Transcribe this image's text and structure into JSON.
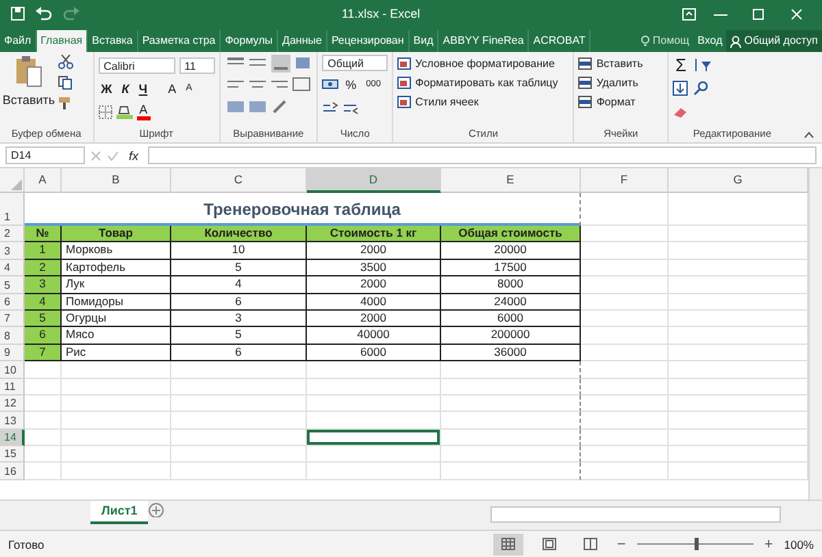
{
  "title_bar": {
    "title": "11.xlsx - Excel"
  },
  "menu_tabs": [
    {
      "label": "Файл",
      "selected": false
    },
    {
      "label": "Главная",
      "selected": true
    },
    {
      "label": "Вставка",
      "selected": false
    },
    {
      "label": "Разметка стра",
      "selected": false
    },
    {
      "label": "Формулы",
      "selected": false
    },
    {
      "label": "Данные",
      "selected": false
    },
    {
      "label": "Рецензирован",
      "selected": false
    },
    {
      "label": "Вид",
      "selected": false
    },
    {
      "label": "ABBYY FineRea",
      "selected": false
    },
    {
      "label": "ACROBAT",
      "selected": false
    }
  ],
  "help": "Помощ",
  "sign_in": "Вход",
  "share": "Общий доступ",
  "ribbon": {
    "clipboard": {
      "label": "Буфер обмена",
      "paste": "Вставить"
    },
    "font": {
      "label": "Шрифт",
      "font": "Calibri",
      "size": "11",
      "bold": "Ж",
      "italic": "К",
      "underline": "Ч",
      "grow": "A",
      "shrink": "A",
      "font_color_letter": "A"
    },
    "alignment": {
      "label": "Выравнивание"
    },
    "number": {
      "label": "Число",
      "format": "Общий",
      "percent": "%",
      "thousands": "000"
    },
    "styles": {
      "label": "Стили",
      "items": [
        "Условное форматирование",
        "Форматировать как таблицу",
        "Стили ячеек"
      ]
    },
    "cells": {
      "label": "Ячейки",
      "items": [
        "Вставить",
        "Удалить",
        "Формат"
      ]
    },
    "editing": {
      "label": "Редактирование",
      "sum": "Σ"
    }
  },
  "formula_bar": {
    "name_box": "D14",
    "fx": "fx"
  },
  "sheet": {
    "columns": [
      {
        "label": "A",
        "selected": false
      },
      {
        "label": "B",
        "selected": false
      },
      {
        "label": "C",
        "selected": false
      },
      {
        "label": "D",
        "selected": true
      },
      {
        "label": "E",
        "selected": false
      },
      {
        "label": "F",
        "selected": false
      },
      {
        "label": "G",
        "selected": false
      }
    ],
    "rows": [
      {
        "label": "1",
        "selected": false
      },
      {
        "label": "2",
        "selected": false
      },
      {
        "label": "3",
        "selected": false
      },
      {
        "label": "4",
        "selected": false
      },
      {
        "label": "5",
        "selected": false
      },
      {
        "label": "6",
        "selected": false
      },
      {
        "label": "7",
        "selected": false
      },
      {
        "label": "8",
        "selected": false
      },
      {
        "label": "9",
        "selected": false
      },
      {
        "label": "10",
        "selected": false
      },
      {
        "label": "11",
        "selected": false
      },
      {
        "label": "12",
        "selected": false
      },
      {
        "label": "13",
        "selected": false
      },
      {
        "label": "14",
        "selected": true
      },
      {
        "label": "15",
        "selected": false
      },
      {
        "label": "16",
        "selected": false
      }
    ],
    "table": {
      "title": "Тренеровочная таблица",
      "header": [
        "№",
        "Товар",
        "Количество",
        "Стоимость 1 кг",
        "Общая стоимость"
      ],
      "rows": [
        [
          "1",
          "Морковь",
          "10",
          "2000",
          "20000"
        ],
        [
          "2",
          "Картофель",
          "5",
          "3500",
          "17500"
        ],
        [
          "3",
          "Лук",
          "4",
          "2000",
          "8000"
        ],
        [
          "4",
          "Помидоры",
          "6",
          "4000",
          "24000"
        ],
        [
          "5",
          "Огурцы",
          "3",
          "2000",
          "6000"
        ],
        [
          "6",
          "Мясо",
          "5",
          "40000",
          "200000"
        ],
        [
          "7",
          "Рис",
          "6",
          "6000",
          "36000"
        ]
      ]
    }
  },
  "sheet_tabs": [
    {
      "label": "Лист1",
      "selected": true
    }
  ],
  "status_bar": {
    "status": "Готово",
    "views": [
      {
        "selected": true
      },
      {
        "selected": false
      },
      {
        "selected": false
      }
    ],
    "zoom_out": "−",
    "zoom_slider": {
      "level": 0.5
    },
    "zoom_in": "+",
    "zoom": "100%"
  }
}
